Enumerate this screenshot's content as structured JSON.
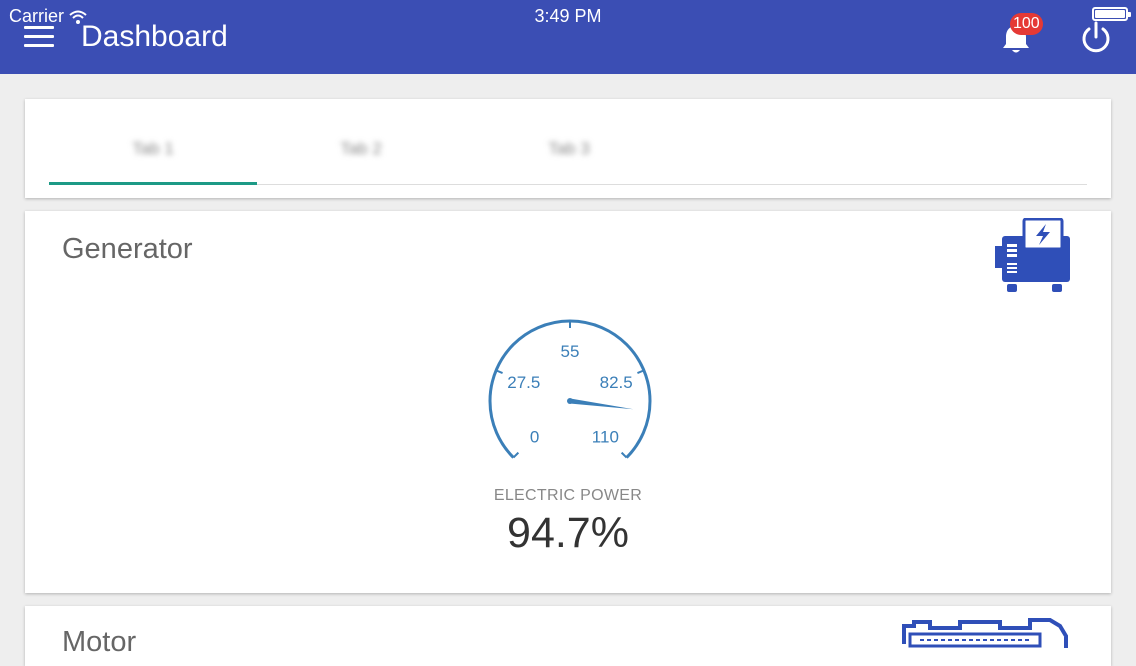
{
  "status_bar": {
    "carrier": "Carrier",
    "time": "3:49 PM"
  },
  "app_bar": {
    "title": "Dashboard",
    "notification_count": "100"
  },
  "tabs": [
    {
      "label": "Tab 1",
      "selected": true
    },
    {
      "label": "Tab 2",
      "selected": false
    },
    {
      "label": "Tab 3",
      "selected": false
    }
  ],
  "generator": {
    "title": "Generator",
    "icon": "generator-icon",
    "gauge": {
      "label": "ELECTRIC POWER",
      "value_text": "94.7%",
      "value": 94.7,
      "min": 0,
      "max": 110,
      "ticks": [
        "0",
        "27.5",
        "55",
        "82.5",
        "110"
      ]
    }
  },
  "motor": {
    "title": "Motor",
    "icon": "motor-icon"
  },
  "colors": {
    "app_bar": "#3b4eb4",
    "tab_indicator": "#1d9a86",
    "gauge": "#3b7fb8",
    "badge": "#e53935",
    "icon": "#2f4fb8"
  }
}
